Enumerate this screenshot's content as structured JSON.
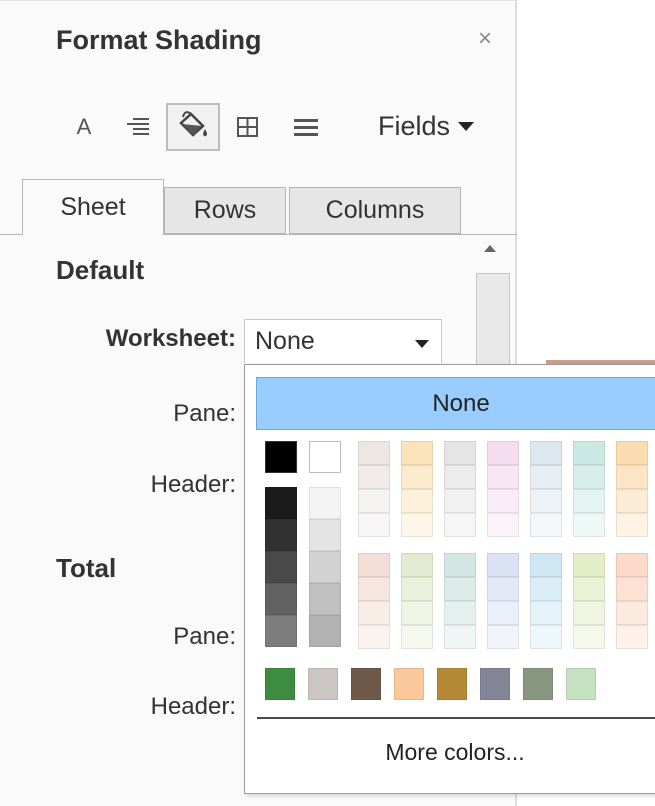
{
  "panel": {
    "title": "Format Shading",
    "close_glyph": "×",
    "toolbar": {
      "font_glyph": "A",
      "fields_label": "Fields",
      "icons": [
        "font-icon",
        "alignment-icon",
        "shading-bucket-icon",
        "borders-icon",
        "lines-icon"
      ],
      "active_icon": "shading-bucket-icon"
    },
    "tabs": [
      {
        "label": "Sheet",
        "active": true
      },
      {
        "label": "Rows",
        "active": false
      },
      {
        "label": "Columns",
        "active": false
      }
    ],
    "default_section": {
      "heading": "Default",
      "worksheet_label": "Worksheet:",
      "worksheet_value": "None",
      "pane_label": "Pane:",
      "header_label": "Header:"
    },
    "total_section": {
      "heading": "Total",
      "pane_label": "Pane:",
      "header_label": "Header:"
    }
  },
  "color_popup": {
    "none_label": "None",
    "selected": "None",
    "more_colors_label": "More colors...",
    "colors": {
      "black": "#000000",
      "white": "#ffffff",
      "grays": [
        "#1b1b1b",
        "#313131",
        "#494949",
        "#626262",
        "#7c7c7c",
        "#f4f4f4",
        "#e4e4e4",
        "#d2d2d2",
        "#c0c0c0",
        "#b2b2b2"
      ],
      "top_tints": [
        [
          "#ede6e3",
          "#f1eceb",
          "#f5f2f2",
          "#f8f6f6"
        ],
        [
          "#fbe3bb",
          "#fcebcc",
          "#fdf1db",
          "#fef6e8"
        ],
        [
          "#e5e5e5",
          "#ececec",
          "#f1f1f1",
          "#f6f6f6"
        ],
        [
          "#f5ddf0",
          "#f8e6f5",
          "#faedf8",
          "#fcf3fa"
        ],
        [
          "#dde7ee",
          "#e6edf3",
          "#edf2f6",
          "#f3f7fa"
        ],
        [
          "#cbe9e4",
          "#d8eeeb",
          "#e4f4f1",
          "#eef8f6"
        ],
        [
          "#fbdcb1",
          "#fce5c4",
          "#fdecd5",
          "#fef3e4"
        ]
      ],
      "bottom_tints": [
        [
          "#f4dfd6",
          "#f7e6df",
          "#f9ede8",
          "#fbf3f0"
        ],
        [
          "#e2ebcf",
          "#e9f0db",
          "#eff4e5",
          "#f5f8ee"
        ],
        [
          "#d2e6e4",
          "#dcece9",
          "#e6f1ef",
          "#eff6f5"
        ],
        [
          "#dbe2f4",
          "#e3e9f7",
          "#eaeff9",
          "#f1f4fb"
        ],
        [
          "#cfe6f3",
          "#dbedf6",
          "#e5f2f8",
          "#eef7fb"
        ],
        [
          "#e2eec5",
          "#e9f2d4",
          "#eff5e1",
          "#f5f9ec"
        ],
        [
          "#fcd9c8",
          "#fde2d4",
          "#fdeadf",
          "#fef2ea"
        ]
      ],
      "accents": [
        "#3d8c40",
        "#cbc6c3",
        "#6e5949",
        "#fbc89c",
        "#b58a37",
        "#858598",
        "#89977f",
        "#c5e2c0"
      ]
    }
  }
}
